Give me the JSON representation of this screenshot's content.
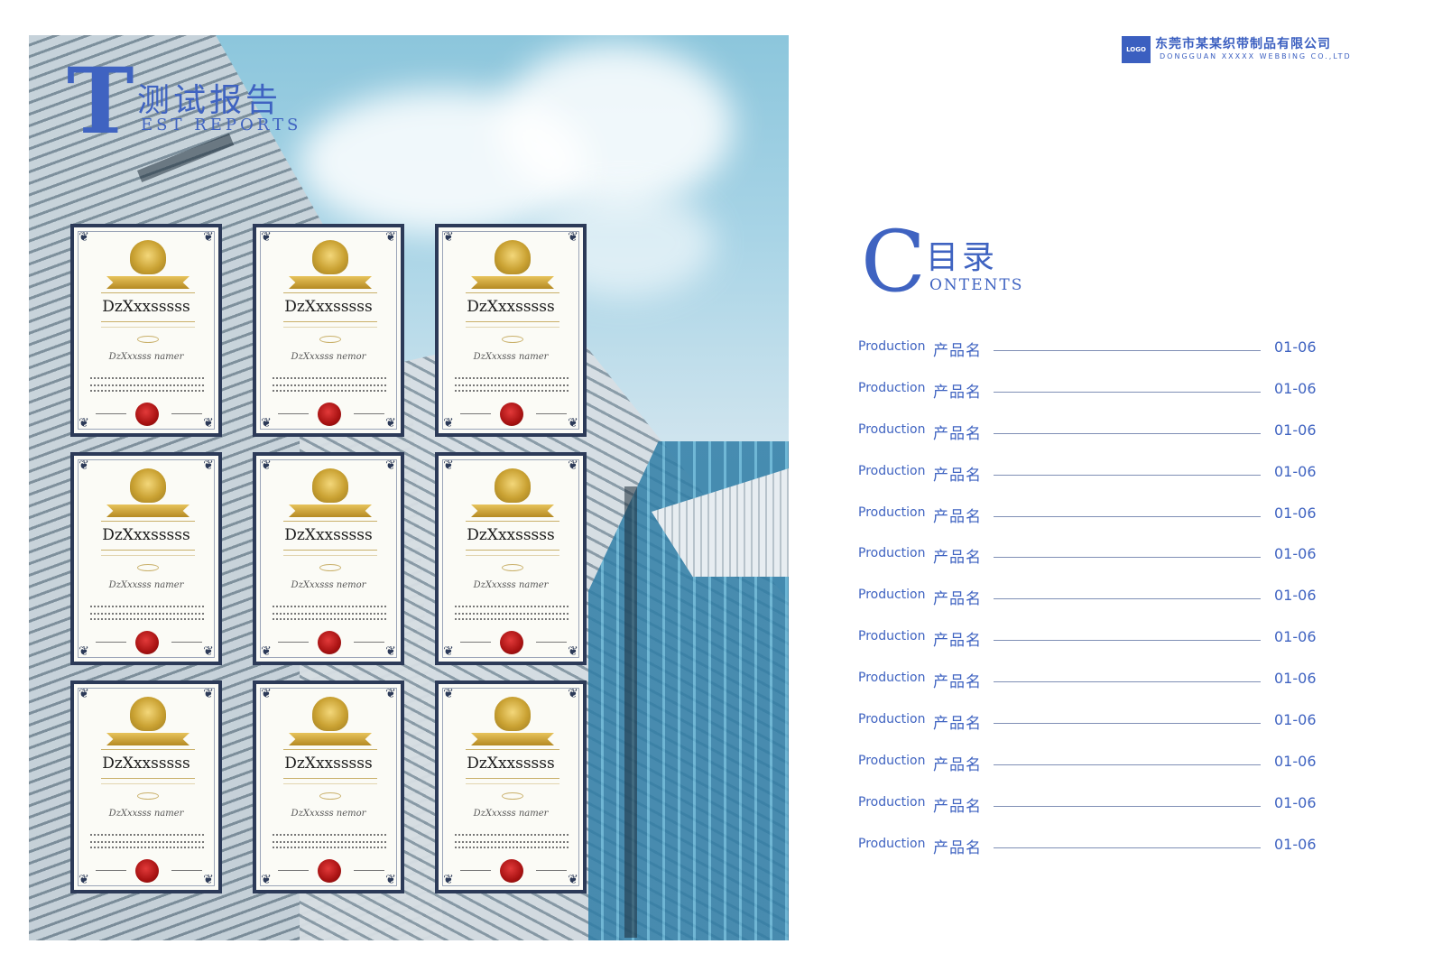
{
  "left_title": {
    "initial": "T",
    "cn": "测试报告",
    "en": "EST REPORTS"
  },
  "certificates": [
    {
      "title": "DzXxxsssss",
      "script": "DzXxxsss namer"
    },
    {
      "title": "DzXxxsssss",
      "script": "DzXxxsss nemor"
    },
    {
      "title": "DzXxxsssss",
      "script": "DzXxxsss namer"
    },
    {
      "title": "DzXxxsssss",
      "script": "DzXxxsss namer"
    },
    {
      "title": "DzXxxsssss",
      "script": "DzXxxsss nemor"
    },
    {
      "title": "DzXxxsssss",
      "script": "DzXxxsss namer"
    },
    {
      "title": "DzXxxsssss",
      "script": "DzXxxsss namer"
    },
    {
      "title": "DzXxxsssss",
      "script": "DzXxxsss nemor"
    },
    {
      "title": "DzXxxsssss",
      "script": "DzXxxsss namer"
    }
  ],
  "brand": {
    "logo_text": "LOGO",
    "company_cn": "东莞市某某织带制品有限公司",
    "company_en": "DONGGUAN XXXXX WEBBING CO.,LTD"
  },
  "contents_title": {
    "initial": "C",
    "cn": "目录",
    "en": "ONTENTS"
  },
  "toc": [
    {
      "en": "Production",
      "cn": "产品名",
      "pages": "01-06"
    },
    {
      "en": "Production",
      "cn": "产品名",
      "pages": "01-06"
    },
    {
      "en": "Production",
      "cn": "产品名",
      "pages": "01-06"
    },
    {
      "en": "Production",
      "cn": "产品名",
      "pages": "01-06"
    },
    {
      "en": "Production",
      "cn": "产品名",
      "pages": "01-06"
    },
    {
      "en": "Production",
      "cn": "产品名",
      "pages": "01-06"
    },
    {
      "en": "Production",
      "cn": "产品名",
      "pages": "01-06"
    },
    {
      "en": "Production",
      "cn": "产品名",
      "pages": "01-06"
    },
    {
      "en": "Production",
      "cn": "产品名",
      "pages": "01-06"
    },
    {
      "en": "Production",
      "cn": "产品名",
      "pages": "01-06"
    },
    {
      "en": "Production",
      "cn": "产品名",
      "pages": "01-06"
    },
    {
      "en": "Production",
      "cn": "产品名",
      "pages": "01-06"
    },
    {
      "en": "Production",
      "cn": "产品名",
      "pages": "01-06"
    }
  ],
  "colors": {
    "accent": "#3f63c1",
    "cert_frame": "#2c3a58",
    "seal": "#a81212",
    "gold": "#caa233"
  }
}
